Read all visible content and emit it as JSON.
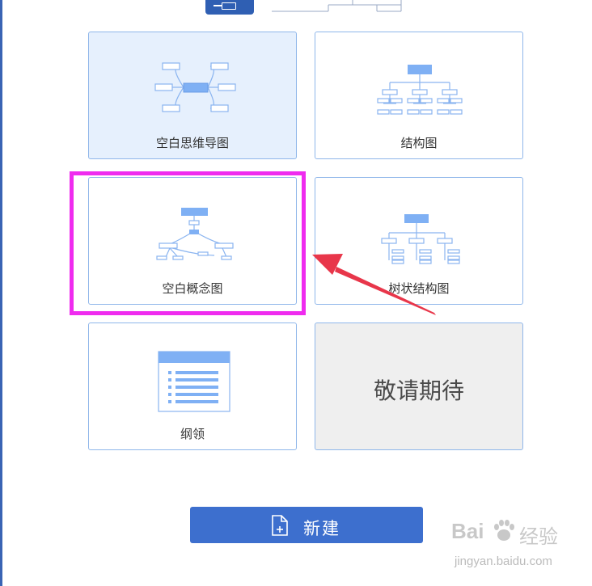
{
  "templates": {
    "mind_map": {
      "label": "空白思维导图"
    },
    "structure": {
      "label": "结构图"
    },
    "concept_map": {
      "label": "空白概念图"
    },
    "tree_structure": {
      "label": "树状结构图"
    },
    "outline": {
      "label": "纲领"
    },
    "coming_soon": {
      "label": "敬请期待"
    }
  },
  "new_button": {
    "label": "新建",
    "icon": "new-document-icon"
  },
  "annotation": {
    "highlight_color": "#ef2bef",
    "arrow_color": "#e8364a"
  },
  "watermark": {
    "brand": "Bai",
    "product": "经验",
    "site": "jingyan.baidu.com"
  },
  "colors": {
    "accent": "#3d6fce",
    "card_border": "#8fb6ea",
    "selected_bg": "#e6f0fd",
    "icon_blue": "#8ab4f0"
  }
}
